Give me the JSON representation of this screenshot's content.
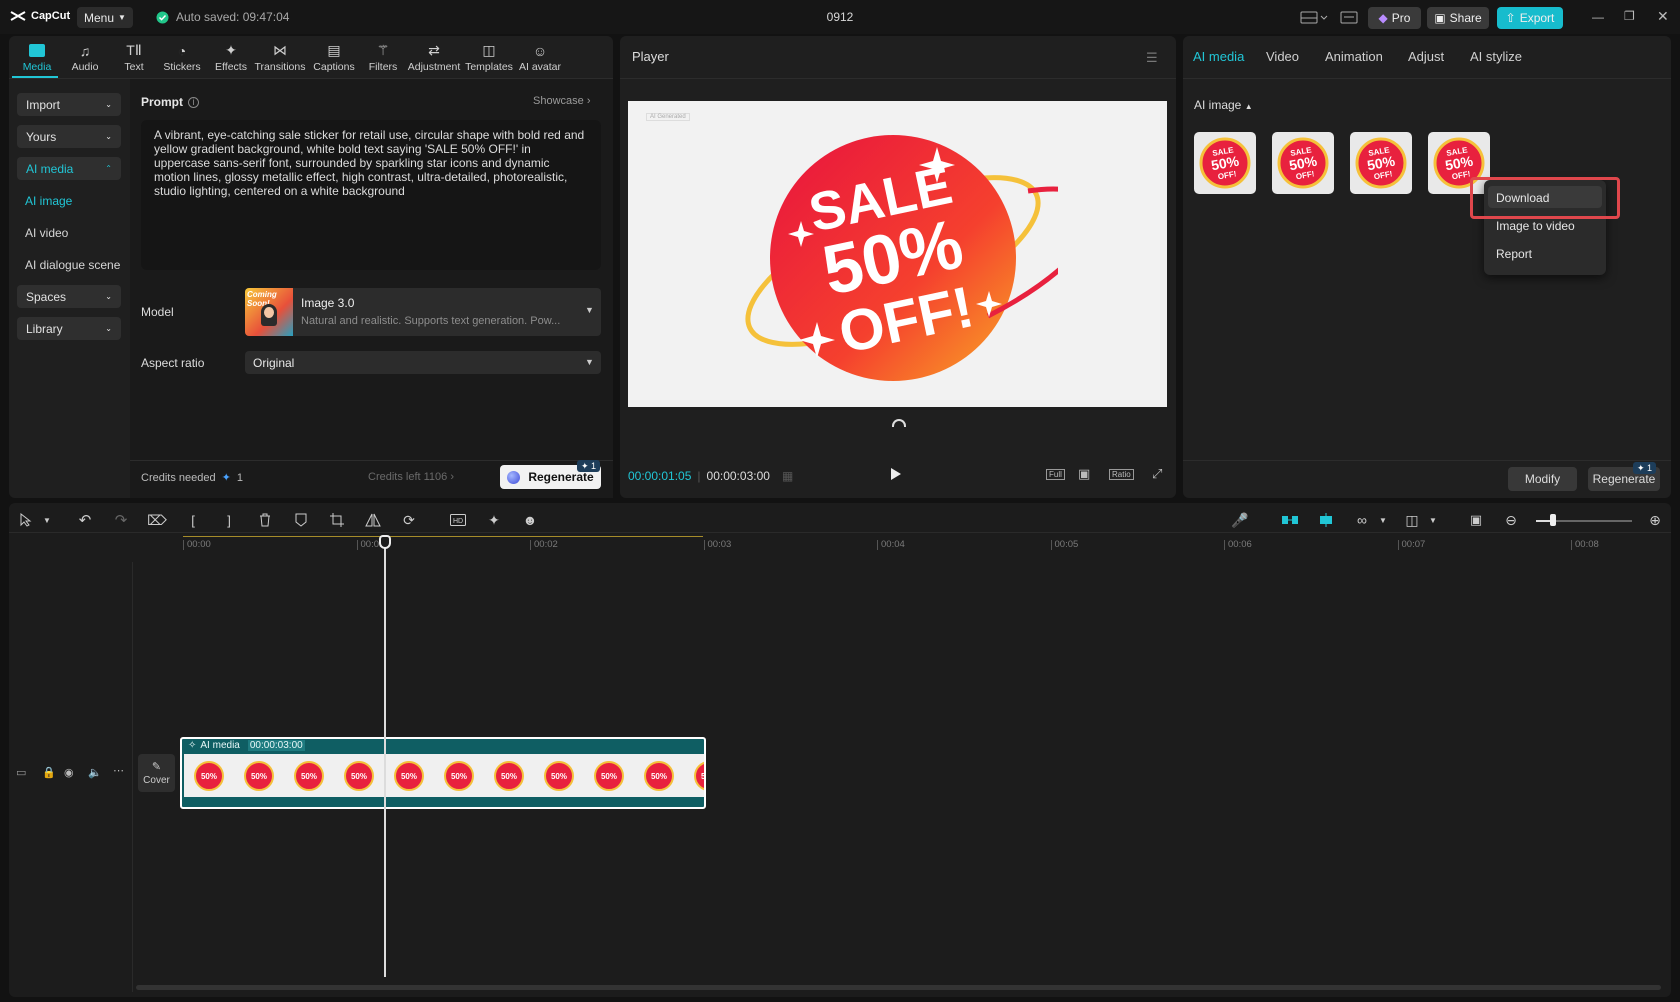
{
  "app": {
    "logo": "CapCut",
    "menu_label": "Menu",
    "autosave": "Auto saved: 09:47:04",
    "title": "0912",
    "pro_label": "Pro",
    "share_label": "Share",
    "export_label": "Export"
  },
  "tools": [
    {
      "label": "Media",
      "icon": "media-icon"
    },
    {
      "label": "Audio",
      "icon": "audio-icon"
    },
    {
      "label": "Text",
      "icon": "text-icon"
    },
    {
      "label": "Stickers",
      "icon": "stickers-icon"
    },
    {
      "label": "Effects",
      "icon": "effects-icon"
    },
    {
      "label": "Transitions",
      "icon": "transitions-icon"
    },
    {
      "label": "Captions",
      "icon": "captions-icon"
    },
    {
      "label": "Filters",
      "icon": "filters-icon"
    },
    {
      "label": "Adjustment",
      "icon": "adjustment-icon"
    },
    {
      "label": "Templates",
      "icon": "templates-icon"
    },
    {
      "label": "AI avatar",
      "icon": "ai-avatar-icon"
    }
  ],
  "sidebar": {
    "import": "Import",
    "yours": "Yours",
    "ai_media": "AI media",
    "ai_image": "AI image",
    "ai_video": "AI video",
    "ai_dialogue": "AI dialogue scene",
    "spaces": "Spaces",
    "library": "Library"
  },
  "prompt": {
    "label": "Prompt",
    "showcase": "Showcase",
    "text": "A vibrant, eye-catching sale sticker for retail use, circular shape with bold red and yellow gradient background, white bold text saying 'SALE 50% OFF!' in uppercase sans-serif font, surrounded by sparkling star icons and dynamic motion lines, glossy metallic effect, high contrast, ultra-detailed, photorealistic, studio lighting, centered on a white background",
    "model_label": "Model",
    "model_name": "Image 3.0",
    "model_desc": "Natural and realistic. Supports text generation. Pow...",
    "model_thumb_text": "Coming Soon!",
    "aspect_label": "Aspect ratio",
    "aspect_value": "Original",
    "credits_needed_label": "Credits needed",
    "credits_needed": "1",
    "credits_left": "Credits left 1106",
    "regenerate": "Regenerate",
    "regen_badge": "1"
  },
  "player": {
    "title": "Player",
    "current_time": "00:00:01:05",
    "total_time": "00:00:03:00",
    "full_label": "Full",
    "ratio_label": "Ratio",
    "watermark": "AI Generated"
  },
  "sticker": {
    "line1": "SALE",
    "line2": "50%",
    "line3": "OFF!"
  },
  "right_panel": {
    "tabs": [
      "AI media",
      "Video",
      "Animation",
      "Adjust",
      "AI stylize"
    ],
    "section": "AI image",
    "context_menu": [
      "Download",
      "Image to video",
      "Report"
    ],
    "modify": "Modify",
    "regenerate": "Regenerate",
    "regen_badge": "1"
  },
  "timeline": {
    "ticks": [
      "00:00",
      "00:01",
      "00:02",
      "00:03",
      "00:04",
      "00:05",
      "00:06",
      "00:07",
      "00:08"
    ],
    "clip_label": "AI media",
    "clip_duration": "00:00:03:00",
    "cover_label": "Cover"
  },
  "colors": {
    "accent": "#21c6d6",
    "highlight": "#e0474c",
    "sticker_red": "#e8213e",
    "sticker_yellow": "#f5c13a"
  }
}
